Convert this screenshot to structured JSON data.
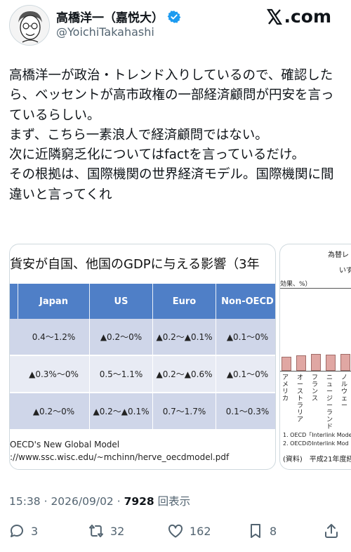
{
  "author": {
    "display_name": "高橋洋一（嘉悦大）",
    "handle": "@YoichiTakahashi"
  },
  "site_logo": ".com",
  "post": {
    "text": "高橋洋一が政治・トレンド入りしているので、確認したら、ベッセントが高市政権の一部経済顧問が円安を言っているらしい。\nまず、こちら一素浪人で経済顧問ではない。\n次に近隣窮乏化についてはfactを言っているだけ。\nその根拠は、国際機関の世界経済モデル。国際機関に間違いと言ってくれ"
  },
  "image1": {
    "title": "貨安が自国、他国のGDPに与える影響（3年",
    "columns": [
      "Japan",
      "US",
      "Euro",
      "Non-OECD"
    ],
    "rows": [
      [
        "0.4～1.2%",
        "▲0.2～0%",
        "▲0.2～▲0.1%",
        "▲0.1～0%"
      ],
      [
        "▲0.3%～0%",
        "0.5～1.1%",
        "▲0.2～▲0.6%",
        "▲0.1～0%"
      ],
      [
        "▲0.2～0%",
        "▲0.2～▲0.1%",
        "0.7～1.7%",
        "0.1～0.3%"
      ]
    ],
    "source_line1": "OECD's New Global Model",
    "source_line2": "://www.ssc.wisc.edu/~mchinn/herve_oecdmodel.pdf"
  },
  "image2": {
    "title": "為替レ",
    "subtitle": "いず",
    "ylabel": "効果、%）",
    "categories": [
      "アメリカ",
      "オーストラリア",
      "フランス",
      "ニュージーランド",
      "ノルウェー"
    ],
    "note1": "1. OECD「Interlink Mode",
    "note2": "2. OECDのInterlink Mod",
    "source": "(資料)　平成21年度経"
  },
  "meta": {
    "time": "15:38 · 2026/09/02 · ",
    "views": "7928",
    "views_label": " 回表示"
  },
  "actions": {
    "replies": "3",
    "reposts": "32",
    "likes": "162",
    "bookmarks": "8"
  },
  "colors": {
    "header_blue": "#4f7fc7",
    "row_dark": "#cfd6e9",
    "row_light": "#e8ebf4",
    "verified": "#1d9bf0"
  }
}
